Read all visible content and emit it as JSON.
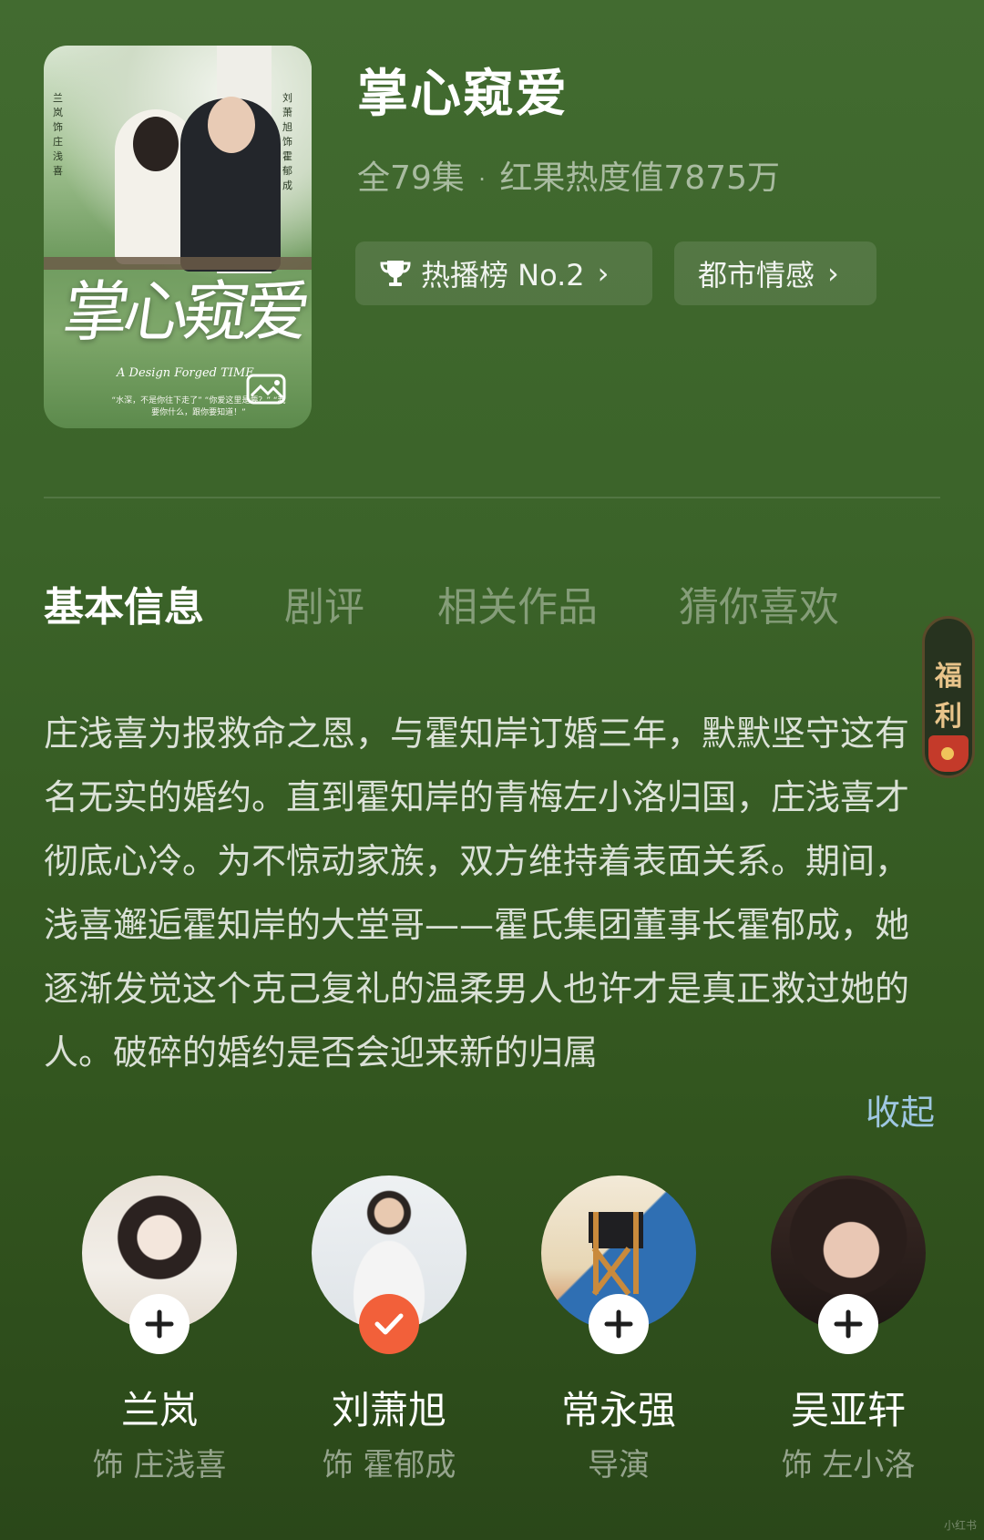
{
  "show": {
    "title": "掌心窥爱",
    "episodes": "全79集",
    "dot": "·",
    "heat": "红果热度值7875万"
  },
  "poster": {
    "calligraphy": "掌心窥爱",
    "subtitle": "A Design Forged TIME",
    "left_credit": "兰岚 饰 庄浅喜",
    "right_credit": "刘萧旭 饰 霍郁成",
    "quote": "“水深，不是你往下走了” “你爱这里是要？” “我要你什么，跟你要知道！”"
  },
  "chips": {
    "rank": "热播榜 No.2",
    "genre": "都市情感",
    "chevron": "›"
  },
  "tabs": [
    "基本信息",
    "剧评",
    "相关作品",
    "猜你喜欢"
  ],
  "synopsis": "庄浅喜为报救命之恩，与霍知岸订婚三年，默默坚守这有名无实的婚约。直到霍知岸的青梅左小洛归国，庄浅喜才彻底心冷。为不惊动家族，双方维持着表面关系。期间，浅喜邂逅霍知岸的大堂哥——霍氏集团董事长霍郁成，她逐渐发觉这个克己复礼的温柔男人也许才是真正救过她的人。破碎的婚约是否会迎来新的归属",
  "collapse_label": "收起",
  "fuli": {
    "line1": "福",
    "line2": "利"
  },
  "cast": [
    {
      "name": "兰岚",
      "role": "饰 庄浅喜",
      "followed": false,
      "icon": "plus-icon"
    },
    {
      "name": "刘萧旭",
      "role": "饰 霍郁成",
      "followed": true,
      "icon": "check-icon"
    },
    {
      "name": "常永强",
      "role": "导演",
      "followed": false,
      "icon": "plus-icon"
    },
    {
      "name": "吴亚轩",
      "role": "饰 左小洛",
      "followed": false,
      "icon": "plus-icon"
    }
  ],
  "watermark": "小红书",
  "colors": {
    "accent_link": "#9fc7e2",
    "followed_badge": "#f2603a",
    "bg": "#3b6329"
  }
}
